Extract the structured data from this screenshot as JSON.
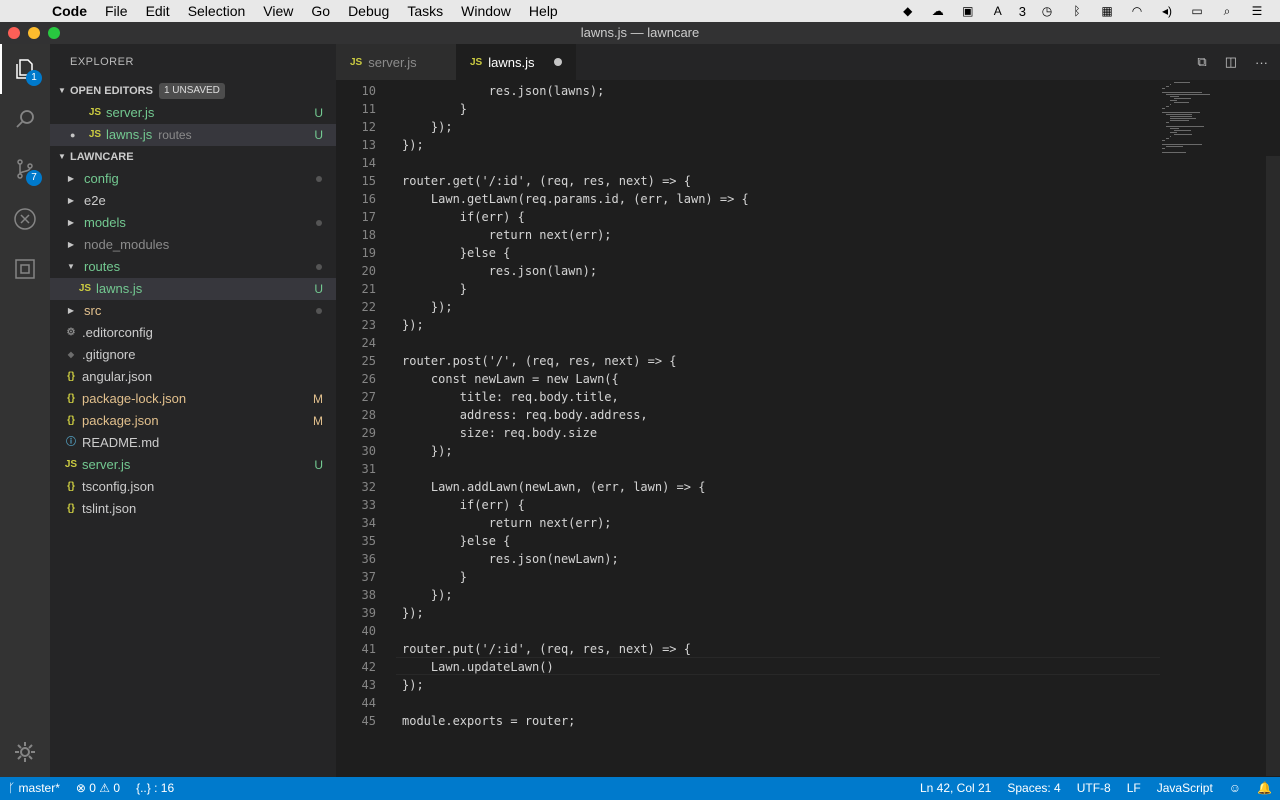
{
  "menubar": {
    "app": "Code",
    "items": [
      "File",
      "Edit",
      "Selection",
      "View",
      "Go",
      "Debug",
      "Tasks",
      "Window",
      "Help"
    ],
    "status_count": "3"
  },
  "window": {
    "title": "lawns.js — lawncare"
  },
  "activity": {
    "explorer_badge": "1",
    "scm_badge": "7"
  },
  "sidebar": {
    "title": "EXPLORER",
    "open_editors": {
      "header": "OPEN EDITORS",
      "unsaved": "1 UNSAVED",
      "files": [
        {
          "icon": "JS",
          "name": "server.js",
          "desc": "",
          "status": "U"
        },
        {
          "icon": "JS",
          "name": "lawns.js",
          "desc": "routes",
          "status": "U"
        }
      ]
    },
    "project": {
      "header": "LAWNCARE",
      "items": [
        {
          "name": "config"
        },
        {
          "name": "e2e"
        },
        {
          "name": "models"
        },
        {
          "name": "node_modules"
        },
        {
          "name": "routes"
        },
        {
          "icon": "JS",
          "name": "lawns.js",
          "status": "U"
        },
        {
          "name": "src"
        },
        {
          "icon": "⚙",
          "name": ".editorconfig"
        },
        {
          "icon": "◆",
          "name": ".gitignore"
        },
        {
          "icon": "{}",
          "name": "angular.json"
        },
        {
          "icon": "{}",
          "name": "package-lock.json",
          "status": "M"
        },
        {
          "icon": "{}",
          "name": "package.json",
          "status": "M"
        },
        {
          "icon": "ⓘ",
          "name": "README.md"
        },
        {
          "icon": "JS",
          "name": "server.js",
          "status": "U"
        },
        {
          "icon": "{}",
          "name": "tsconfig.json"
        },
        {
          "icon": "{}",
          "name": "tslint.json"
        }
      ]
    }
  },
  "tabs": [
    {
      "icon": "JS",
      "name": "server.js"
    },
    {
      "icon": "JS",
      "name": "lawns.js"
    }
  ],
  "editor": {
    "lines": [
      {
        "n": "10",
        "code": "            res.json(lawns);"
      },
      {
        "n": "11",
        "code": "        }"
      },
      {
        "n": "12",
        "code": "    });"
      },
      {
        "n": "13",
        "code": "});"
      },
      {
        "n": "14",
        "code": ""
      },
      {
        "n": "15",
        "code": "router.get('/:id', (req, res, next) => {"
      },
      {
        "n": "16",
        "code": "    Lawn.getLawn(req.params.id, (err, lawn) => {"
      },
      {
        "n": "17",
        "code": "        if(err) {"
      },
      {
        "n": "18",
        "code": "            return next(err);"
      },
      {
        "n": "19",
        "code": "        }else {"
      },
      {
        "n": "20",
        "code": "            res.json(lawn);"
      },
      {
        "n": "21",
        "code": "        }"
      },
      {
        "n": "22",
        "code": "    });"
      },
      {
        "n": "23",
        "code": "});"
      },
      {
        "n": "24",
        "code": ""
      },
      {
        "n": "25",
        "code": "router.post('/', (req, res, next) => {"
      },
      {
        "n": "26",
        "code": "    const newLawn = new Lawn({"
      },
      {
        "n": "27",
        "code": "        title: req.body.title,"
      },
      {
        "n": "28",
        "code": "        address: req.body.address,"
      },
      {
        "n": "29",
        "code": "        size: req.body.size"
      },
      {
        "n": "30",
        "code": "    });"
      },
      {
        "n": "31",
        "code": ""
      },
      {
        "n": "32",
        "code": "    Lawn.addLawn(newLawn, (err, lawn) => {"
      },
      {
        "n": "33",
        "code": "        if(err) {"
      },
      {
        "n": "34",
        "code": "            return next(err);"
      },
      {
        "n": "35",
        "code": "        }else {"
      },
      {
        "n": "36",
        "code": "            res.json(newLawn);"
      },
      {
        "n": "37",
        "code": "        }"
      },
      {
        "n": "38",
        "code": "    });"
      },
      {
        "n": "39",
        "code": "});"
      },
      {
        "n": "40",
        "code": ""
      },
      {
        "n": "41",
        "code": "router.put('/:id', (req, res, next) => {"
      },
      {
        "n": "42",
        "code": "    Lawn.updateLawn()"
      },
      {
        "n": "43",
        "code": "});"
      },
      {
        "n": "44",
        "code": ""
      },
      {
        "n": "45",
        "code": "module.exports = router;"
      }
    ]
  },
  "statusbar": {
    "branch": "master*",
    "errors": "0",
    "warnings": "0",
    "breadcrumb": "{..} : 16",
    "position": "Ln 42, Col 21",
    "spaces": "Spaces: 4",
    "encoding": "UTF-8",
    "eol": "LF",
    "language": "JavaScript"
  }
}
